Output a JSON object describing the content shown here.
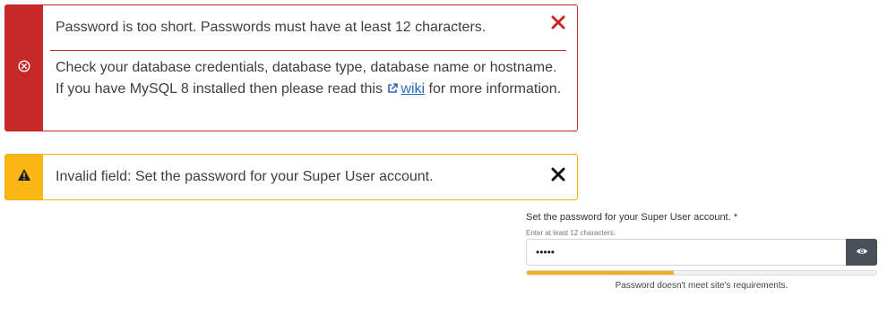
{
  "alerts": {
    "danger": {
      "heading": "Password is too short. Passwords must have at least 12 characters.",
      "text_before_link": "Check your database credentials, database type, database name or hostname. If you have MySQL 8 installed then please read this ",
      "link_label": "wiki",
      "text_after_link": " for more information.",
      "side_icon": "circle-x-icon",
      "close_icon": "close-icon",
      "color": "#c52827"
    },
    "warning": {
      "text": "Invalid field: Set the password for your Super User account.",
      "side_icon": "warning-triangle-icon",
      "close_icon": "close-icon",
      "color": "#f9b614"
    }
  },
  "password_field": {
    "label": "Set the password for your Super User account. *",
    "hint": "Enter at least 12 characters.",
    "value": "•••••",
    "toggle_icon": "eye-icon",
    "strength_fraction": 0.42,
    "strength_color": "#f2b01e",
    "strength_message": "Password doesn't meet site's requirements."
  }
}
